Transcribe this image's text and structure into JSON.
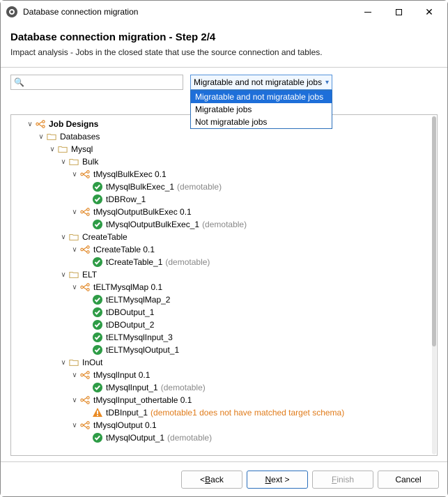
{
  "window": {
    "title": "Database connection migration"
  },
  "header": {
    "heading": "Database connection migration - Step 2/4",
    "subheading": "Impact analysis - Jobs in the closed state that use the source connection and tables."
  },
  "search": {
    "value": ""
  },
  "filter": {
    "selected": "Migratable and not migratable jobs",
    "options": [
      "Migratable and not migratable jobs",
      "Migratable jobs",
      "Not migratable jobs"
    ]
  },
  "notes": {
    "demotable": "(demotable)",
    "warn": "(demotable1 does not have matched target schema)"
  },
  "t": {
    "root": "Job Designs",
    "databases": "Databases",
    "mysql": "Mysql",
    "bulk": "Bulk",
    "bulkexec": "tMysqlBulkExec 0.1",
    "bulkexec1": "tMysqlBulkExec_1",
    "dbrow1": "tDBRow_1",
    "outbulkexec": "tMysqlOutputBulkExec 0.1",
    "outbulkexec1": "tMysqlOutputBulkExec_1",
    "createtable": "CreateTable",
    "tcreatetable": "tCreateTable 0.1",
    "tcreatetable1": "tCreateTable_1",
    "elt": "ELT",
    "eltmap": "tELTMysqlMap 0.1",
    "eltmap2": "tELTMysqlMap_2",
    "dboutput1": "tDBOutput_1",
    "dboutput2": "tDBOutput_2",
    "eltinput3": "tELTMysqlInput_3",
    "eltoutput1": "tELTMysqlOutput_1",
    "inout": "InOut",
    "mysqlinput": "tMysqlInput 0.1",
    "mysqlinput1": "tMysqlInput_1",
    "mysqlinputother": "tMysqlInput_othertable 0.1",
    "tdbinput1": "tDBInput_1",
    "mysqloutput": "tMysqlOutput 0.1",
    "mysqloutput1": "tMysqlOutput_1"
  },
  "footer": {
    "back": "< Back",
    "next": "Next >",
    "finish": "Finish",
    "cancel": "Cancel"
  }
}
